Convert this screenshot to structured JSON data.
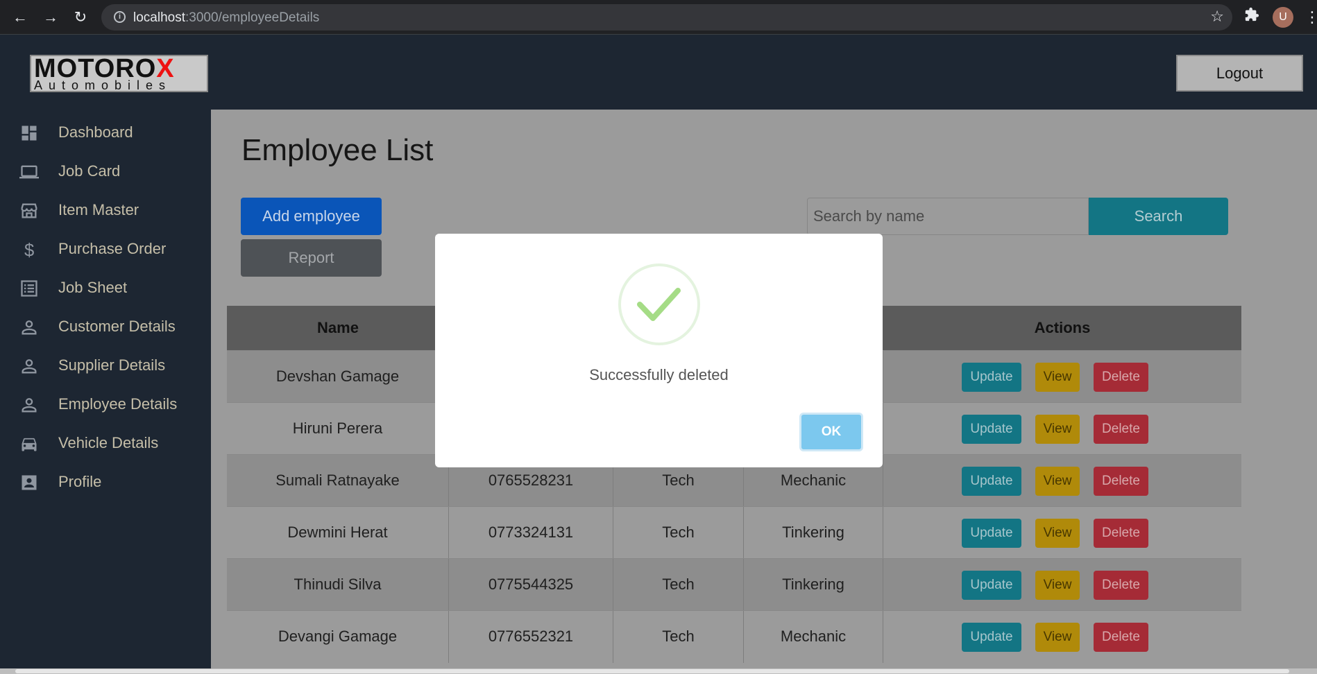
{
  "browser": {
    "url_host": "localhost",
    "url_path": ":3000/employeeDetails",
    "profile_initial": "U"
  },
  "header": {
    "logo_main": "MOTORO",
    "logo_x": "X",
    "logo_sub": "Automobiles",
    "logout_label": "Logout"
  },
  "sidebar": {
    "items": [
      {
        "label": "Dashboard",
        "icon": "dashboard-icon"
      },
      {
        "label": "Job Card",
        "icon": "laptop-icon"
      },
      {
        "label": "Item Master",
        "icon": "store-icon"
      },
      {
        "label": "Purchase Order",
        "icon": "dollar-icon"
      },
      {
        "label": "Job Sheet",
        "icon": "list-icon"
      },
      {
        "label": "Customer Details",
        "icon": "person-icon"
      },
      {
        "label": "Supplier Details",
        "icon": "person-icon"
      },
      {
        "label": "Employee Details",
        "icon": "person-icon"
      },
      {
        "label": "Vehicle Details",
        "icon": "car-icon"
      },
      {
        "label": "Profile",
        "icon": "profile-card-icon"
      }
    ]
  },
  "main": {
    "title": "Employee List",
    "add_label": "Add employee",
    "report_label": "Report",
    "search_placeholder": "Search by name",
    "search_label": "Search"
  },
  "table": {
    "headers": [
      "Name",
      "",
      "",
      "",
      "Actions"
    ],
    "action_labels": {
      "update": "Update",
      "view": "View",
      "delete": "Delete"
    },
    "rows": [
      {
        "name": "Devshan Gamage",
        "phone": "",
        "dept": "",
        "role": ""
      },
      {
        "name": "Hiruni Perera",
        "phone": "",
        "dept": "",
        "role": ""
      },
      {
        "name": "Sumali Ratnayake",
        "phone": "0765528231",
        "dept": "Tech",
        "role": "Mechanic"
      },
      {
        "name": "Dewmini Herat",
        "phone": "0773324131",
        "dept": "Tech",
        "role": "Tinkering"
      },
      {
        "name": "Thinudi Silva",
        "phone": "0775544325",
        "dept": "Tech",
        "role": "Tinkering"
      },
      {
        "name": "Devangi Gamage",
        "phone": "0776552321",
        "dept": "Tech",
        "role": "Mechanic"
      }
    ]
  },
  "modal": {
    "message": "Successfully deleted",
    "ok_label": "OK"
  },
  "colors": {
    "sidebar_bg": "#1d2632",
    "overlay_bg": "#9b9b9b",
    "primary": "#0a55b8",
    "info": "#137584",
    "warning": "#b08a0a",
    "danger": "#a52b36",
    "success": "#a5dc86"
  }
}
